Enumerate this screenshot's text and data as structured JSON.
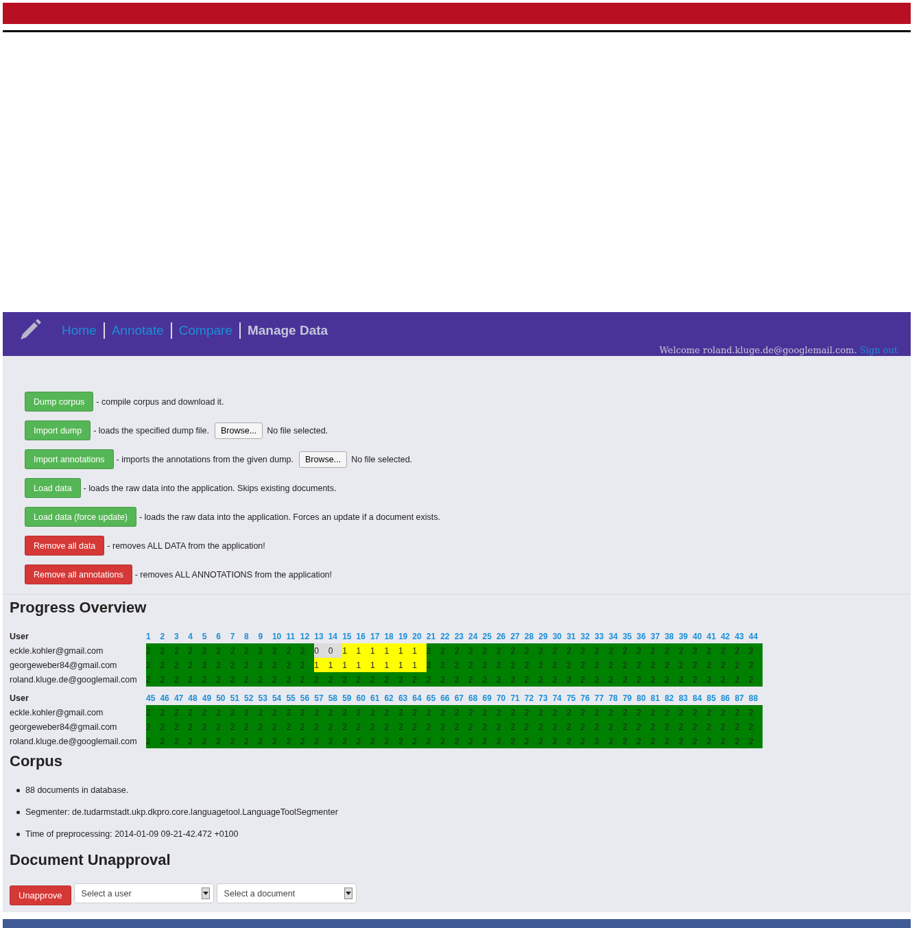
{
  "nav": {
    "items": [
      {
        "label": "Home",
        "selected": false
      },
      {
        "label": "Annotate",
        "selected": false
      },
      {
        "label": "Compare",
        "selected": false
      },
      {
        "label": "Manage Data",
        "selected": true
      }
    ],
    "welcome": "Welcome roland.kluge.de@googlemail.com.",
    "sign_out": "Sign out"
  },
  "actions": [
    {
      "label": "Dump corpus",
      "kind": "safe",
      "description": "- compile corpus and download it."
    },
    {
      "label": "Import dump",
      "kind": "safe",
      "description": "- loads the specified dump file.",
      "file": {
        "button": "Browse...",
        "status": "No file selected."
      }
    },
    {
      "label": "Import annotations",
      "kind": "safe",
      "description": "- imports the annotations from the given dump.",
      "file": {
        "button": "Browse...",
        "status": "No file selected."
      }
    },
    {
      "label": "Load data",
      "kind": "safe",
      "description": "- loads the raw data into the application. Skips existing documents."
    },
    {
      "label": "Load data (force update)",
      "kind": "safe",
      "description": "- loads the raw data into the application. Forces an update if a document exists."
    },
    {
      "label": "Remove all data",
      "kind": "danger",
      "description": "- removes ALL DATA from the application!"
    },
    {
      "label": "Remove all annotations",
      "kind": "danger",
      "description": "- removes ALL ANNOTATIONS from the application!"
    }
  ],
  "progress": {
    "title": "Progress Overview",
    "tables": [
      {
        "user_header": "User",
        "columns": [
          "1",
          "2",
          "3",
          "4",
          "5",
          "6",
          "7",
          "8",
          "9",
          "10",
          "11",
          "12",
          "13",
          "14",
          "15",
          "16",
          "17",
          "18",
          "19",
          "20",
          "21",
          "22",
          "23",
          "24",
          "25",
          "26",
          "27",
          "28",
          "29",
          "30",
          "31",
          "32",
          "33",
          "34",
          "35",
          "36",
          "37",
          "38",
          "39",
          "40",
          "41",
          "42",
          "43",
          "44"
        ],
        "rows": [
          {
            "user": "eckle.kohler@gmail.com",
            "cells": [
              {
                "value": "2",
                "color": "#008000"
              },
              {
                "value": "2",
                "color": "#008000"
              },
              {
                "value": "2",
                "color": "#008000"
              },
              {
                "value": "2",
                "color": "#008000"
              },
              {
                "value": "2",
                "color": "#008000"
              },
              {
                "value": "2",
                "color": "#008000"
              },
              {
                "value": "2",
                "color": "#008000"
              },
              {
                "value": "2",
                "color": "#008000"
              },
              {
                "value": "2",
                "color": "#008000"
              },
              {
                "value": "2",
                "color": "#008000"
              },
              {
                "value": "2",
                "color": "#008000"
              },
              {
                "value": "2",
                "color": "#008000"
              },
              {
                "value": "0",
                "color": "#dcdcdc"
              },
              {
                "value": "0",
                "color": "#dcdcdc"
              },
              {
                "value": "1",
                "color": "#ffff00"
              },
              {
                "value": "1",
                "color": "#ffff00"
              },
              {
                "value": "1",
                "color": "#ffff00"
              },
              {
                "value": "1",
                "color": "#ffff00"
              },
              {
                "value": "1",
                "color": "#ffff00"
              },
              {
                "value": "1",
                "color": "#ffff00"
              },
              {
                "value": "2",
                "color": "#008000"
              },
              {
                "value": "2",
                "color": "#008000"
              },
              {
                "value": "2",
                "color": "#008000"
              },
              {
                "value": "2",
                "color": "#008000"
              },
              {
                "value": "2",
                "color": "#008000"
              },
              {
                "value": "2",
                "color": "#008000"
              },
              {
                "value": "2",
                "color": "#008000"
              },
              {
                "value": "2",
                "color": "#008000"
              },
              {
                "value": "2",
                "color": "#008000"
              },
              {
                "value": "2",
                "color": "#008000"
              },
              {
                "value": "2",
                "color": "#008000"
              },
              {
                "value": "2",
                "color": "#008000"
              },
              {
                "value": "2",
                "color": "#008000"
              },
              {
                "value": "2",
                "color": "#008000"
              },
              {
                "value": "2",
                "color": "#008000"
              },
              {
                "value": "2",
                "color": "#008000"
              },
              {
                "value": "2",
                "color": "#008000"
              },
              {
                "value": "2",
                "color": "#008000"
              },
              {
                "value": "2",
                "color": "#008000"
              },
              {
                "value": "2",
                "color": "#008000"
              },
              {
                "value": "2",
                "color": "#008000"
              },
              {
                "value": "2",
                "color": "#008000"
              },
              {
                "value": "2",
                "color": "#008000"
              },
              {
                "value": "2",
                "color": "#008000"
              }
            ]
          },
          {
            "user": "georgeweber84@gmail.com",
            "cells": [
              {
                "value": "2",
                "color": "#008000"
              },
              {
                "value": "2",
                "color": "#008000"
              },
              {
                "value": "2",
                "color": "#008000"
              },
              {
                "value": "2",
                "color": "#008000"
              },
              {
                "value": "2",
                "color": "#008000"
              },
              {
                "value": "2",
                "color": "#008000"
              },
              {
                "value": "2",
                "color": "#008000"
              },
              {
                "value": "2",
                "color": "#008000"
              },
              {
                "value": "2",
                "color": "#008000"
              },
              {
                "value": "2",
                "color": "#008000"
              },
              {
                "value": "2",
                "color": "#008000"
              },
              {
                "value": "2",
                "color": "#008000"
              },
              {
                "value": "1",
                "color": "#ffff00"
              },
              {
                "value": "1",
                "color": "#ffff00"
              },
              {
                "value": "1",
                "color": "#ffff00"
              },
              {
                "value": "1",
                "color": "#ffff00"
              },
              {
                "value": "1",
                "color": "#ffff00"
              },
              {
                "value": "1",
                "color": "#ffff00"
              },
              {
                "value": "1",
                "color": "#ffff00"
              },
              {
                "value": "1",
                "color": "#ffff00"
              },
              {
                "value": "2",
                "color": "#008000"
              },
              {
                "value": "2",
                "color": "#008000"
              },
              {
                "value": "2",
                "color": "#008000"
              },
              {
                "value": "2",
                "color": "#008000"
              },
              {
                "value": "2",
                "color": "#008000"
              },
              {
                "value": "2",
                "color": "#008000"
              },
              {
                "value": "2",
                "color": "#008000"
              },
              {
                "value": "2",
                "color": "#008000"
              },
              {
                "value": "2",
                "color": "#008000"
              },
              {
                "value": "2",
                "color": "#008000"
              },
              {
                "value": "2",
                "color": "#008000"
              },
              {
                "value": "2",
                "color": "#008000"
              },
              {
                "value": "2",
                "color": "#008000"
              },
              {
                "value": "2",
                "color": "#008000"
              },
              {
                "value": "2",
                "color": "#008000"
              },
              {
                "value": "2",
                "color": "#008000"
              },
              {
                "value": "2",
                "color": "#008000"
              },
              {
                "value": "2",
                "color": "#008000"
              },
              {
                "value": "2",
                "color": "#008000"
              },
              {
                "value": "2",
                "color": "#008000"
              },
              {
                "value": "2",
                "color": "#008000"
              },
              {
                "value": "2",
                "color": "#008000"
              },
              {
                "value": "2",
                "color": "#008000"
              },
              {
                "value": "2",
                "color": "#008000"
              }
            ]
          },
          {
            "user": "roland.kluge.de@googlemail.com",
            "cells": [
              {
                "value": "2",
                "color": "#008000"
              },
              {
                "value": "2",
                "color": "#008000"
              },
              {
                "value": "2",
                "color": "#008000"
              },
              {
                "value": "2",
                "color": "#008000"
              },
              {
                "value": "2",
                "color": "#008000"
              },
              {
                "value": "2",
                "color": "#008000"
              },
              {
                "value": "2",
                "color": "#008000"
              },
              {
                "value": "2",
                "color": "#008000"
              },
              {
                "value": "2",
                "color": "#008000"
              },
              {
                "value": "2",
                "color": "#008000"
              },
              {
                "value": "2",
                "color": "#008000"
              },
              {
                "value": "2",
                "color": "#008000"
              },
              {
                "value": "2",
                "color": "#008000"
              },
              {
                "value": "2",
                "color": "#008000"
              },
              {
                "value": "2",
                "color": "#008000"
              },
              {
                "value": "2",
                "color": "#008000"
              },
              {
                "value": "2",
                "color": "#008000"
              },
              {
                "value": "2",
                "color": "#008000"
              },
              {
                "value": "2",
                "color": "#008000"
              },
              {
                "value": "2",
                "color": "#008000"
              },
              {
                "value": "2",
                "color": "#008000"
              },
              {
                "value": "2",
                "color": "#008000"
              },
              {
                "value": "2",
                "color": "#008000"
              },
              {
                "value": "2",
                "color": "#008000"
              },
              {
                "value": "2",
                "color": "#008000"
              },
              {
                "value": "2",
                "color": "#008000"
              },
              {
                "value": "2",
                "color": "#008000"
              },
              {
                "value": "2",
                "color": "#008000"
              },
              {
                "value": "2",
                "color": "#008000"
              },
              {
                "value": "2",
                "color": "#008000"
              },
              {
                "value": "2",
                "color": "#008000"
              },
              {
                "value": "2",
                "color": "#008000"
              },
              {
                "value": "2",
                "color": "#008000"
              },
              {
                "value": "2",
                "color": "#008000"
              },
              {
                "value": "2",
                "color": "#008000"
              },
              {
                "value": "2",
                "color": "#008000"
              },
              {
                "value": "2",
                "color": "#008000"
              },
              {
                "value": "2",
                "color": "#008000"
              },
              {
                "value": "2",
                "color": "#008000"
              },
              {
                "value": "2",
                "color": "#008000"
              },
              {
                "value": "2",
                "color": "#008000"
              },
              {
                "value": "2",
                "color": "#008000"
              },
              {
                "value": "2",
                "color": "#008000"
              },
              {
                "value": "2",
                "color": "#008000"
              }
            ]
          }
        ]
      },
      {
        "user_header": "User",
        "columns": [
          "45",
          "46",
          "47",
          "48",
          "49",
          "50",
          "51",
          "52",
          "53",
          "54",
          "55",
          "56",
          "57",
          "58",
          "59",
          "60",
          "61",
          "62",
          "63",
          "64",
          "65",
          "66",
          "67",
          "68",
          "69",
          "70",
          "71",
          "72",
          "73",
          "74",
          "75",
          "76",
          "77",
          "78",
          "79",
          "80",
          "81",
          "82",
          "83",
          "84",
          "85",
          "86",
          "87",
          "88"
        ],
        "rows": [
          {
            "user": "eckle.kohler@gmail.com",
            "cells": [
              {
                "value": "2",
                "color": "#008000"
              },
              {
                "value": "2",
                "color": "#008000"
              },
              {
                "value": "2",
                "color": "#008000"
              },
              {
                "value": "2",
                "color": "#008000"
              },
              {
                "value": "2",
                "color": "#008000"
              },
              {
                "value": "2",
                "color": "#008000"
              },
              {
                "value": "2",
                "color": "#008000"
              },
              {
                "value": "2",
                "color": "#008000"
              },
              {
                "value": "2",
                "color": "#008000"
              },
              {
                "value": "2",
                "color": "#008000"
              },
              {
                "value": "2",
                "color": "#008000"
              },
              {
                "value": "2",
                "color": "#008000"
              },
              {
                "value": "2",
                "color": "#008000"
              },
              {
                "value": "2",
                "color": "#008000"
              },
              {
                "value": "2",
                "color": "#008000"
              },
              {
                "value": "2",
                "color": "#008000"
              },
              {
                "value": "2",
                "color": "#008000"
              },
              {
                "value": "2",
                "color": "#008000"
              },
              {
                "value": "2",
                "color": "#008000"
              },
              {
                "value": "2",
                "color": "#008000"
              },
              {
                "value": "2",
                "color": "#008000"
              },
              {
                "value": "2",
                "color": "#008000"
              },
              {
                "value": "2",
                "color": "#008000"
              },
              {
                "value": "2",
                "color": "#008000"
              },
              {
                "value": "2",
                "color": "#008000"
              },
              {
                "value": "2",
                "color": "#008000"
              },
              {
                "value": "2",
                "color": "#008000"
              },
              {
                "value": "2",
                "color": "#008000"
              },
              {
                "value": "2",
                "color": "#008000"
              },
              {
                "value": "2",
                "color": "#008000"
              },
              {
                "value": "2",
                "color": "#008000"
              },
              {
                "value": "2",
                "color": "#008000"
              },
              {
                "value": "2",
                "color": "#008000"
              },
              {
                "value": "2",
                "color": "#008000"
              },
              {
                "value": "2",
                "color": "#008000"
              },
              {
                "value": "2",
                "color": "#008000"
              },
              {
                "value": "2",
                "color": "#008000"
              },
              {
                "value": "2",
                "color": "#008000"
              },
              {
                "value": "2",
                "color": "#008000"
              },
              {
                "value": "2",
                "color": "#008000"
              },
              {
                "value": "2",
                "color": "#008000"
              },
              {
                "value": "2",
                "color": "#008000"
              },
              {
                "value": "2",
                "color": "#008000"
              },
              {
                "value": "2",
                "color": "#008000"
              }
            ]
          },
          {
            "user": "georgeweber84@gmail.com",
            "cells": [
              {
                "value": "2",
                "color": "#008000"
              },
              {
                "value": "2",
                "color": "#008000"
              },
              {
                "value": "2",
                "color": "#008000"
              },
              {
                "value": "2",
                "color": "#008000"
              },
              {
                "value": "2",
                "color": "#008000"
              },
              {
                "value": "2",
                "color": "#008000"
              },
              {
                "value": "2",
                "color": "#008000"
              },
              {
                "value": "2",
                "color": "#008000"
              },
              {
                "value": "2",
                "color": "#008000"
              },
              {
                "value": "2",
                "color": "#008000"
              },
              {
                "value": "2",
                "color": "#008000"
              },
              {
                "value": "2",
                "color": "#008000"
              },
              {
                "value": "2",
                "color": "#008000"
              },
              {
                "value": "2",
                "color": "#008000"
              },
              {
                "value": "2",
                "color": "#008000"
              },
              {
                "value": "2",
                "color": "#008000"
              },
              {
                "value": "2",
                "color": "#008000"
              },
              {
                "value": "2",
                "color": "#008000"
              },
              {
                "value": "2",
                "color": "#008000"
              },
              {
                "value": "2",
                "color": "#008000"
              },
              {
                "value": "2",
                "color": "#008000"
              },
              {
                "value": "2",
                "color": "#008000"
              },
              {
                "value": "2",
                "color": "#008000"
              },
              {
                "value": "2",
                "color": "#008000"
              },
              {
                "value": "2",
                "color": "#008000"
              },
              {
                "value": "2",
                "color": "#008000"
              },
              {
                "value": "2",
                "color": "#008000"
              },
              {
                "value": "2",
                "color": "#008000"
              },
              {
                "value": "2",
                "color": "#008000"
              },
              {
                "value": "2",
                "color": "#008000"
              },
              {
                "value": "2",
                "color": "#008000"
              },
              {
                "value": "2",
                "color": "#008000"
              },
              {
                "value": "2",
                "color": "#008000"
              },
              {
                "value": "2",
                "color": "#008000"
              },
              {
                "value": "2",
                "color": "#008000"
              },
              {
                "value": "2",
                "color": "#008000"
              },
              {
                "value": "2",
                "color": "#008000"
              },
              {
                "value": "2",
                "color": "#008000"
              },
              {
                "value": "2",
                "color": "#008000"
              },
              {
                "value": "2",
                "color": "#008000"
              },
              {
                "value": "2",
                "color": "#008000"
              },
              {
                "value": "2",
                "color": "#008000"
              },
              {
                "value": "2",
                "color": "#008000"
              },
              {
                "value": "2",
                "color": "#008000"
              }
            ]
          },
          {
            "user": "roland.kluge.de@googlemail.com",
            "cells": [
              {
                "value": "2",
                "color": "#008000"
              },
              {
                "value": "2",
                "color": "#008000"
              },
              {
                "value": "2",
                "color": "#008000"
              },
              {
                "value": "2",
                "color": "#008000"
              },
              {
                "value": "2",
                "color": "#008000"
              },
              {
                "value": "2",
                "color": "#008000"
              },
              {
                "value": "2",
                "color": "#008000"
              },
              {
                "value": "2",
                "color": "#008000"
              },
              {
                "value": "2",
                "color": "#008000"
              },
              {
                "value": "2",
                "color": "#008000"
              },
              {
                "value": "2",
                "color": "#008000"
              },
              {
                "value": "2",
                "color": "#008000"
              },
              {
                "value": "2",
                "color": "#008000"
              },
              {
                "value": "2",
                "color": "#008000"
              },
              {
                "value": "2",
                "color": "#008000"
              },
              {
                "value": "2",
                "color": "#008000"
              },
              {
                "value": "2",
                "color": "#008000"
              },
              {
                "value": "2",
                "color": "#008000"
              },
              {
                "value": "2",
                "color": "#008000"
              },
              {
                "value": "2",
                "color": "#008000"
              },
              {
                "value": "2",
                "color": "#008000"
              },
              {
                "value": "2",
                "color": "#008000"
              },
              {
                "value": "2",
                "color": "#008000"
              },
              {
                "value": "2",
                "color": "#008000"
              },
              {
                "value": "2",
                "color": "#008000"
              },
              {
                "value": "2",
                "color": "#008000"
              },
              {
                "value": "2",
                "color": "#008000"
              },
              {
                "value": "2",
                "color": "#008000"
              },
              {
                "value": "2",
                "color": "#008000"
              },
              {
                "value": "2",
                "color": "#008000"
              },
              {
                "value": "2",
                "color": "#008000"
              },
              {
                "value": "2",
                "color": "#008000"
              },
              {
                "value": "2",
                "color": "#008000"
              },
              {
                "value": "2",
                "color": "#008000"
              },
              {
                "value": "2",
                "color": "#008000"
              },
              {
                "value": "2",
                "color": "#008000"
              },
              {
                "value": "2",
                "color": "#008000"
              },
              {
                "value": "2",
                "color": "#008000"
              },
              {
                "value": "2",
                "color": "#008000"
              },
              {
                "value": "2",
                "color": "#008000"
              },
              {
                "value": "2",
                "color": "#008000"
              },
              {
                "value": "2",
                "color": "#008000"
              },
              {
                "value": "2",
                "color": "#008000"
              },
              {
                "value": "2",
                "color": "#008000"
              }
            ]
          }
        ]
      }
    ]
  },
  "corpus": {
    "title": "Corpus",
    "items": [
      "88 documents in database.",
      "Segmenter: de.tudarmstadt.ukp.dkpro.core.languagetool.LanguageToolSegmenter",
      "Time of preprocessing: 2014-01-09 09-21-42.472 +0100"
    ]
  },
  "unapproval": {
    "title": "Document Unapproval",
    "button": "Unapprove",
    "user_select": {
      "placeholder": "Select a user"
    },
    "document_select": {
      "placeholder": "Select a document"
    }
  }
}
